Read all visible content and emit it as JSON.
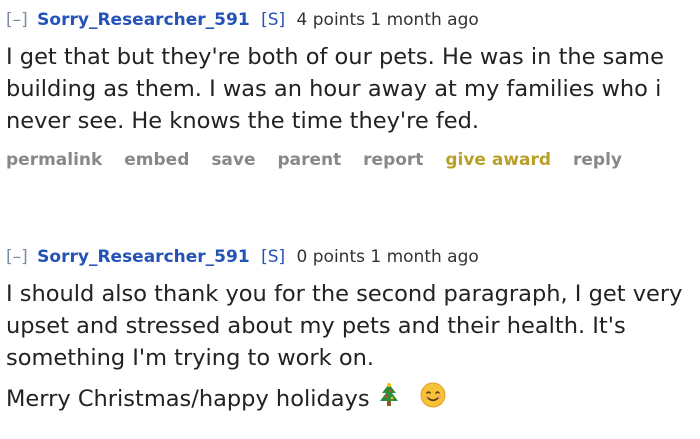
{
  "comments": [
    {
      "expand": "[–]",
      "author": "Sorry_Researcher_591",
      "submitter": "[S]",
      "score": "4 points",
      "time": "1 month ago",
      "paragraphs": [
        "I get that but they're both of our pets. He was in the same building as them. I was an hour away at my families who i never see. He knows the time they're fed."
      ],
      "buttons": {
        "permalink": "permalink",
        "embed": "embed",
        "save": "save",
        "parent": "parent",
        "report": "report",
        "give_award": "give award",
        "reply": "reply"
      }
    },
    {
      "expand": "[–]",
      "author": "Sorry_Researcher_591",
      "submitter": "[S]",
      "score": "0 points",
      "time": "1 month ago",
      "paragraphs": [
        "I should also thank you for the second paragraph, I get very upset and stressed about my pets and their health. It's something I'm trying to work on.",
        "Merry Christmas/happy holidays"
      ],
      "emojis": [
        "christmas-tree-icon",
        "smiling-face-icon"
      ]
    }
  ],
  "colors": {
    "author": "#2453b8",
    "award": "#b8a02a",
    "button": "#888888",
    "expand": "#7a8aa5"
  }
}
